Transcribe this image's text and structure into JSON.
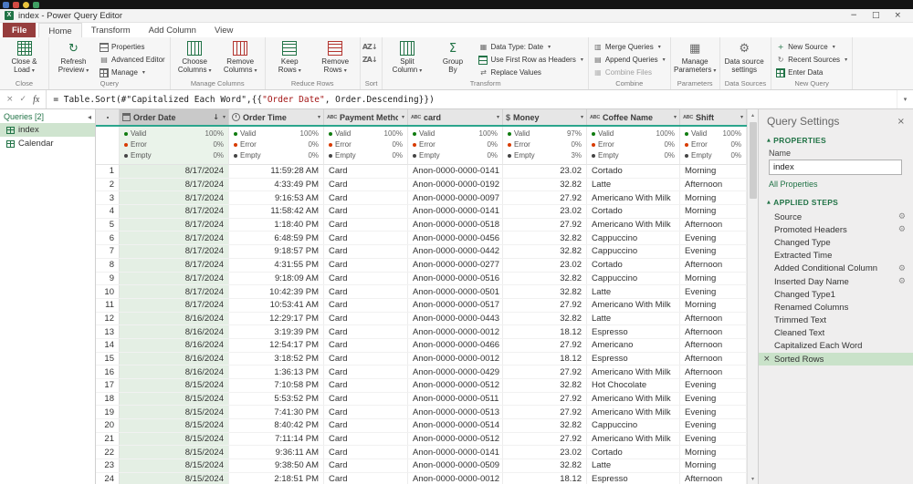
{
  "window": {
    "title": "index - Power Query Editor"
  },
  "icons": {
    "minimize": "−",
    "maximize": "□",
    "close": "×",
    "cancel": "×",
    "check": "✓",
    "fx": "fx",
    "dropdown": "▾",
    "collapse_left": "◂",
    "section_triangle": "▲",
    "gear": "⚙",
    "sort_desc": "↓",
    "filter": "▾",
    "delete": "×",
    "scroll_up": "▴",
    "scroll_down": "▾",
    "excel_logo": "X"
  },
  "colors": {
    "accent_green": "#217346",
    "file_tab": "#963d3d",
    "selection_green": "#cfe4cf",
    "column_selection": "#e4efe4",
    "header_teal": "#2ba58c",
    "valid_dot": "#107c10",
    "error_dot": "#d83b01",
    "empty_dot": "#444444"
  },
  "ribbon": {
    "tabs": [
      {
        "label": "File",
        "file": true
      },
      {
        "label": "Home",
        "active": true
      },
      {
        "label": "Transform"
      },
      {
        "label": "Add Column"
      },
      {
        "label": "View"
      }
    ],
    "groups": [
      {
        "label": "Close",
        "items": [
          {
            "type": "big",
            "name": "close-and-load",
            "lines": [
              "Close &",
              "Load"
            ],
            "icon": "close-load-icon",
            "menu": true
          }
        ]
      },
      {
        "label": "Query",
        "items": [
          {
            "type": "big",
            "name": "refresh-preview",
            "lines": [
              "Refresh",
              "Preview"
            ],
            "icon": "refresh-icon",
            "menu": true
          },
          {
            "type": "small",
            "label": "Properties",
            "icon": "properties-icon"
          },
          {
            "type": "small",
            "label": "Advanced Editor",
            "icon": "advanced-editor-icon"
          },
          {
            "type": "small",
            "label": "Manage",
            "icon": "manage-icon",
            "menu": true
          }
        ]
      },
      {
        "label": "Manage Columns",
        "items": [
          {
            "type": "big",
            "name": "choose-columns",
            "lines": [
              "Choose",
              "Columns"
            ],
            "icon": "choose-columns-icon",
            "menu": true
          },
          {
            "type": "big",
            "name": "remove-columns",
            "lines": [
              "Remove",
              "Columns"
            ],
            "icon": "remove-columns-icon",
            "menu": true
          }
        ]
      },
      {
        "label": "Reduce Rows",
        "items": [
          {
            "type": "big",
            "name": "keep-rows",
            "lines": [
              "Keep",
              "Rows"
            ],
            "icon": "keep-rows-icon",
            "menu": true
          },
          {
            "type": "big",
            "name": "remove-rows",
            "lines": [
              "Remove",
              "Rows"
            ],
            "icon": "remove-rows-icon",
            "menu": true
          }
        ]
      },
      {
        "label": "Sort",
        "items": [
          {
            "type": "small",
            "label": "",
            "name": "sort-ascending",
            "icon": "sort-az-icon"
          },
          {
            "type": "small",
            "label": "",
            "name": "sort-descending",
            "icon": "sort-za-icon"
          }
        ]
      },
      {
        "label": "Transform",
        "items": [
          {
            "type": "big",
            "name": "split-column",
            "lines": [
              "Split",
              "Column"
            ],
            "icon": "split-column-icon",
            "menu": true
          },
          {
            "type": "big",
            "name": "group-by",
            "lines": [
              "Group",
              "By"
            ],
            "icon": "group-by-icon"
          },
          {
            "type": "small",
            "label": "Data Type: Date",
            "icon": "data-type-icon",
            "menu": true
          },
          {
            "type": "small",
            "label": "Use First Row as Headers",
            "icon": "first-row-headers-icon",
            "menu": true
          },
          {
            "type": "small",
            "label": "Replace Values",
            "icon": "replace-values-icon"
          }
        ]
      },
      {
        "label": "Combine",
        "items": [
          {
            "type": "small",
            "label": "Merge Queries",
            "icon": "merge-queries-icon",
            "menu": true
          },
          {
            "type": "small",
            "label": "Append Queries",
            "icon": "append-queries-icon",
            "menu": true
          },
          {
            "type": "small",
            "label": "Combine Files",
            "icon": "combine-files-icon",
            "disabled": true
          }
        ]
      },
      {
        "label": "Parameters",
        "items": [
          {
            "type": "big",
            "name": "manage-parameters",
            "lines": [
              "Manage",
              "Parameters"
            ],
            "icon": "manage-parameters-icon",
            "menu": true
          }
        ]
      },
      {
        "label": "Data Sources",
        "items": [
          {
            "type": "big",
            "name": "data-source-settings",
            "lines": [
              "Data source",
              "settings"
            ],
            "icon": "data-source-settings-icon"
          }
        ]
      },
      {
        "label": "New Query",
        "items": [
          {
            "type": "small",
            "label": "New Source",
            "icon": "new-source-icon",
            "menu": true
          },
          {
            "type": "small",
            "label": "Recent Sources",
            "icon": "recent-sources-icon",
            "menu": true
          },
          {
            "type": "small",
            "label": "Enter Data",
            "icon": "enter-data-icon"
          }
        ]
      }
    ]
  },
  "formula": {
    "segments": [
      {
        "text": "= Table.Sort(#\"Capitalized Each Word\",{{",
        "color": "#1e1e1e"
      },
      {
        "text": "\"Order Date\"",
        "color": "#a31515"
      },
      {
        "text": ", Order.Descending}})",
        "color": "#1e1e1e"
      }
    ]
  },
  "queries": {
    "header": "Queries [2]",
    "items": [
      {
        "label": "index",
        "selected": true
      },
      {
        "label": "Calendar"
      }
    ]
  },
  "table": {
    "quality_labels": {
      "valid": "Valid",
      "error": "Error",
      "empty": "Empty"
    },
    "columns": [
      {
        "name": "Order Date",
        "type_icon": "calendar-icon",
        "sorted": "desc",
        "selected": true,
        "align": "right",
        "quality": {
          "valid": "100%",
          "error": "0%",
          "empty": "0%"
        }
      },
      {
        "name": "Order Time",
        "type_icon": "clock-icon",
        "align": "right",
        "quality": {
          "valid": "100%",
          "error": "0%",
          "empty": "0%"
        }
      },
      {
        "name": "Payment Method",
        "type_icon": "text-icon",
        "align": "left",
        "quality": {
          "valid": "100%",
          "error": "0%",
          "empty": "0%"
        }
      },
      {
        "name": "card",
        "type_icon": "text-icon",
        "align": "left",
        "quality": {
          "valid": "100%",
          "error": "0%",
          "empty": "0%"
        }
      },
      {
        "name": "Money",
        "type_icon": "currency-icon",
        "align": "right",
        "quality": {
          "valid": "97%",
          "error": "0%",
          "empty": "3%"
        }
      },
      {
        "name": "Coffee Name",
        "type_icon": "text-icon",
        "align": "left",
        "quality": {
          "valid": "100%",
          "error": "0%",
          "empty": "0%"
        }
      },
      {
        "name": "Shift",
        "type_icon": "text-icon",
        "align": "left",
        "quality": {
          "valid": "100%",
          "error": "0%",
          "empty": "0%"
        }
      }
    ],
    "rows": [
      [
        "8/17/2024",
        "11:59:28 AM",
        "Card",
        "Anon-0000-0000-0141",
        "23.02",
        "Cortado",
        "Morning"
      ],
      [
        "8/17/2024",
        "4:33:49 PM",
        "Card",
        "Anon-0000-0000-0192",
        "32.82",
        "Latte",
        "Afternoon"
      ],
      [
        "8/17/2024",
        "9:16:53 AM",
        "Card",
        "Anon-0000-0000-0097",
        "27.92",
        "Americano With Milk",
        "Morning"
      ],
      [
        "8/17/2024",
        "11:58:42 AM",
        "Card",
        "Anon-0000-0000-0141",
        "23.02",
        "Cortado",
        "Morning"
      ],
      [
        "8/17/2024",
        "1:18:40 PM",
        "Card",
        "Anon-0000-0000-0518",
        "27.92",
        "Americano With Milk",
        "Afternoon"
      ],
      [
        "8/17/2024",
        "6:48:59 PM",
        "Card",
        "Anon-0000-0000-0456",
        "32.82",
        "Cappuccino",
        "Evening"
      ],
      [
        "8/17/2024",
        "9:18:57 PM",
        "Card",
        "Anon-0000-0000-0442",
        "32.82",
        "Cappuccino",
        "Evening"
      ],
      [
        "8/17/2024",
        "4:31:55 PM",
        "Card",
        "Anon-0000-0000-0277",
        "23.02",
        "Cortado",
        "Afternoon"
      ],
      [
        "8/17/2024",
        "9:18:09 AM",
        "Card",
        "Anon-0000-0000-0516",
        "32.82",
        "Cappuccino",
        "Morning"
      ],
      [
        "8/17/2024",
        "10:42:39 PM",
        "Card",
        "Anon-0000-0000-0501",
        "32.82",
        "Latte",
        "Evening"
      ],
      [
        "8/17/2024",
        "10:53:41 AM",
        "Card",
        "Anon-0000-0000-0517",
        "27.92",
        "Americano With Milk",
        "Morning"
      ],
      [
        "8/16/2024",
        "12:29:17 PM",
        "Card",
        "Anon-0000-0000-0443",
        "32.82",
        "Latte",
        "Afternoon"
      ],
      [
        "8/16/2024",
        "3:19:39 PM",
        "Card",
        "Anon-0000-0000-0012",
        "18.12",
        "Espresso",
        "Afternoon"
      ],
      [
        "8/16/2024",
        "12:54:17 PM",
        "Card",
        "Anon-0000-0000-0466",
        "27.92",
        "Americano",
        "Afternoon"
      ],
      [
        "8/16/2024",
        "3:18:52 PM",
        "Card",
        "Anon-0000-0000-0012",
        "18.12",
        "Espresso",
        "Afternoon"
      ],
      [
        "8/16/2024",
        "1:36:13 PM",
        "Card",
        "Anon-0000-0000-0429",
        "27.92",
        "Americano With Milk",
        "Afternoon"
      ],
      [
        "8/15/2024",
        "7:10:58 PM",
        "Card",
        "Anon-0000-0000-0512",
        "32.82",
        "Hot Chocolate",
        "Evening"
      ],
      [
        "8/15/2024",
        "5:53:52 PM",
        "Card",
        "Anon-0000-0000-0511",
        "27.92",
        "Americano With Milk",
        "Evening"
      ],
      [
        "8/15/2024",
        "7:41:30 PM",
        "Card",
        "Anon-0000-0000-0513",
        "27.92",
        "Americano With Milk",
        "Evening"
      ],
      [
        "8/15/2024",
        "8:40:42 PM",
        "Card",
        "Anon-0000-0000-0514",
        "32.82",
        "Cappuccino",
        "Evening"
      ],
      [
        "8/15/2024",
        "7:11:14 PM",
        "Card",
        "Anon-0000-0000-0512",
        "27.92",
        "Americano With Milk",
        "Evening"
      ],
      [
        "8/15/2024",
        "9:36:11 AM",
        "Card",
        "Anon-0000-0000-0141",
        "23.02",
        "Cortado",
        "Morning"
      ],
      [
        "8/15/2024",
        "9:38:50 AM",
        "Card",
        "Anon-0000-0000-0509",
        "32.82",
        "Latte",
        "Morning"
      ],
      [
        "8/15/2024",
        "2:18:51 PM",
        "Card",
        "Anon-0000-0000-0012",
        "18.12",
        "Espresso",
        "Afternoon"
      ]
    ]
  },
  "settings": {
    "title": "Query Settings",
    "properties_header": "PROPERTIES",
    "name_label": "Name",
    "name_value": "index",
    "all_properties": "All Properties",
    "applied_steps_header": "APPLIED STEPS",
    "applied_steps": [
      {
        "label": "Source",
        "gear": true
      },
      {
        "label": "Promoted Headers",
        "gear": true
      },
      {
        "label": "Changed Type"
      },
      {
        "label": "Extracted Time"
      },
      {
        "label": "Added Conditional Column",
        "gear": true
      },
      {
        "label": "Inserted Day Name",
        "gear": true
      },
      {
        "label": "Changed Type1"
      },
      {
        "label": "Renamed Columns"
      },
      {
        "label": "Trimmed Text"
      },
      {
        "label": "Cleaned Text"
      },
      {
        "label": "Capitalized Each Word"
      },
      {
        "label": "Sorted Rows",
        "selected": true,
        "deletable": true
      }
    ]
  }
}
